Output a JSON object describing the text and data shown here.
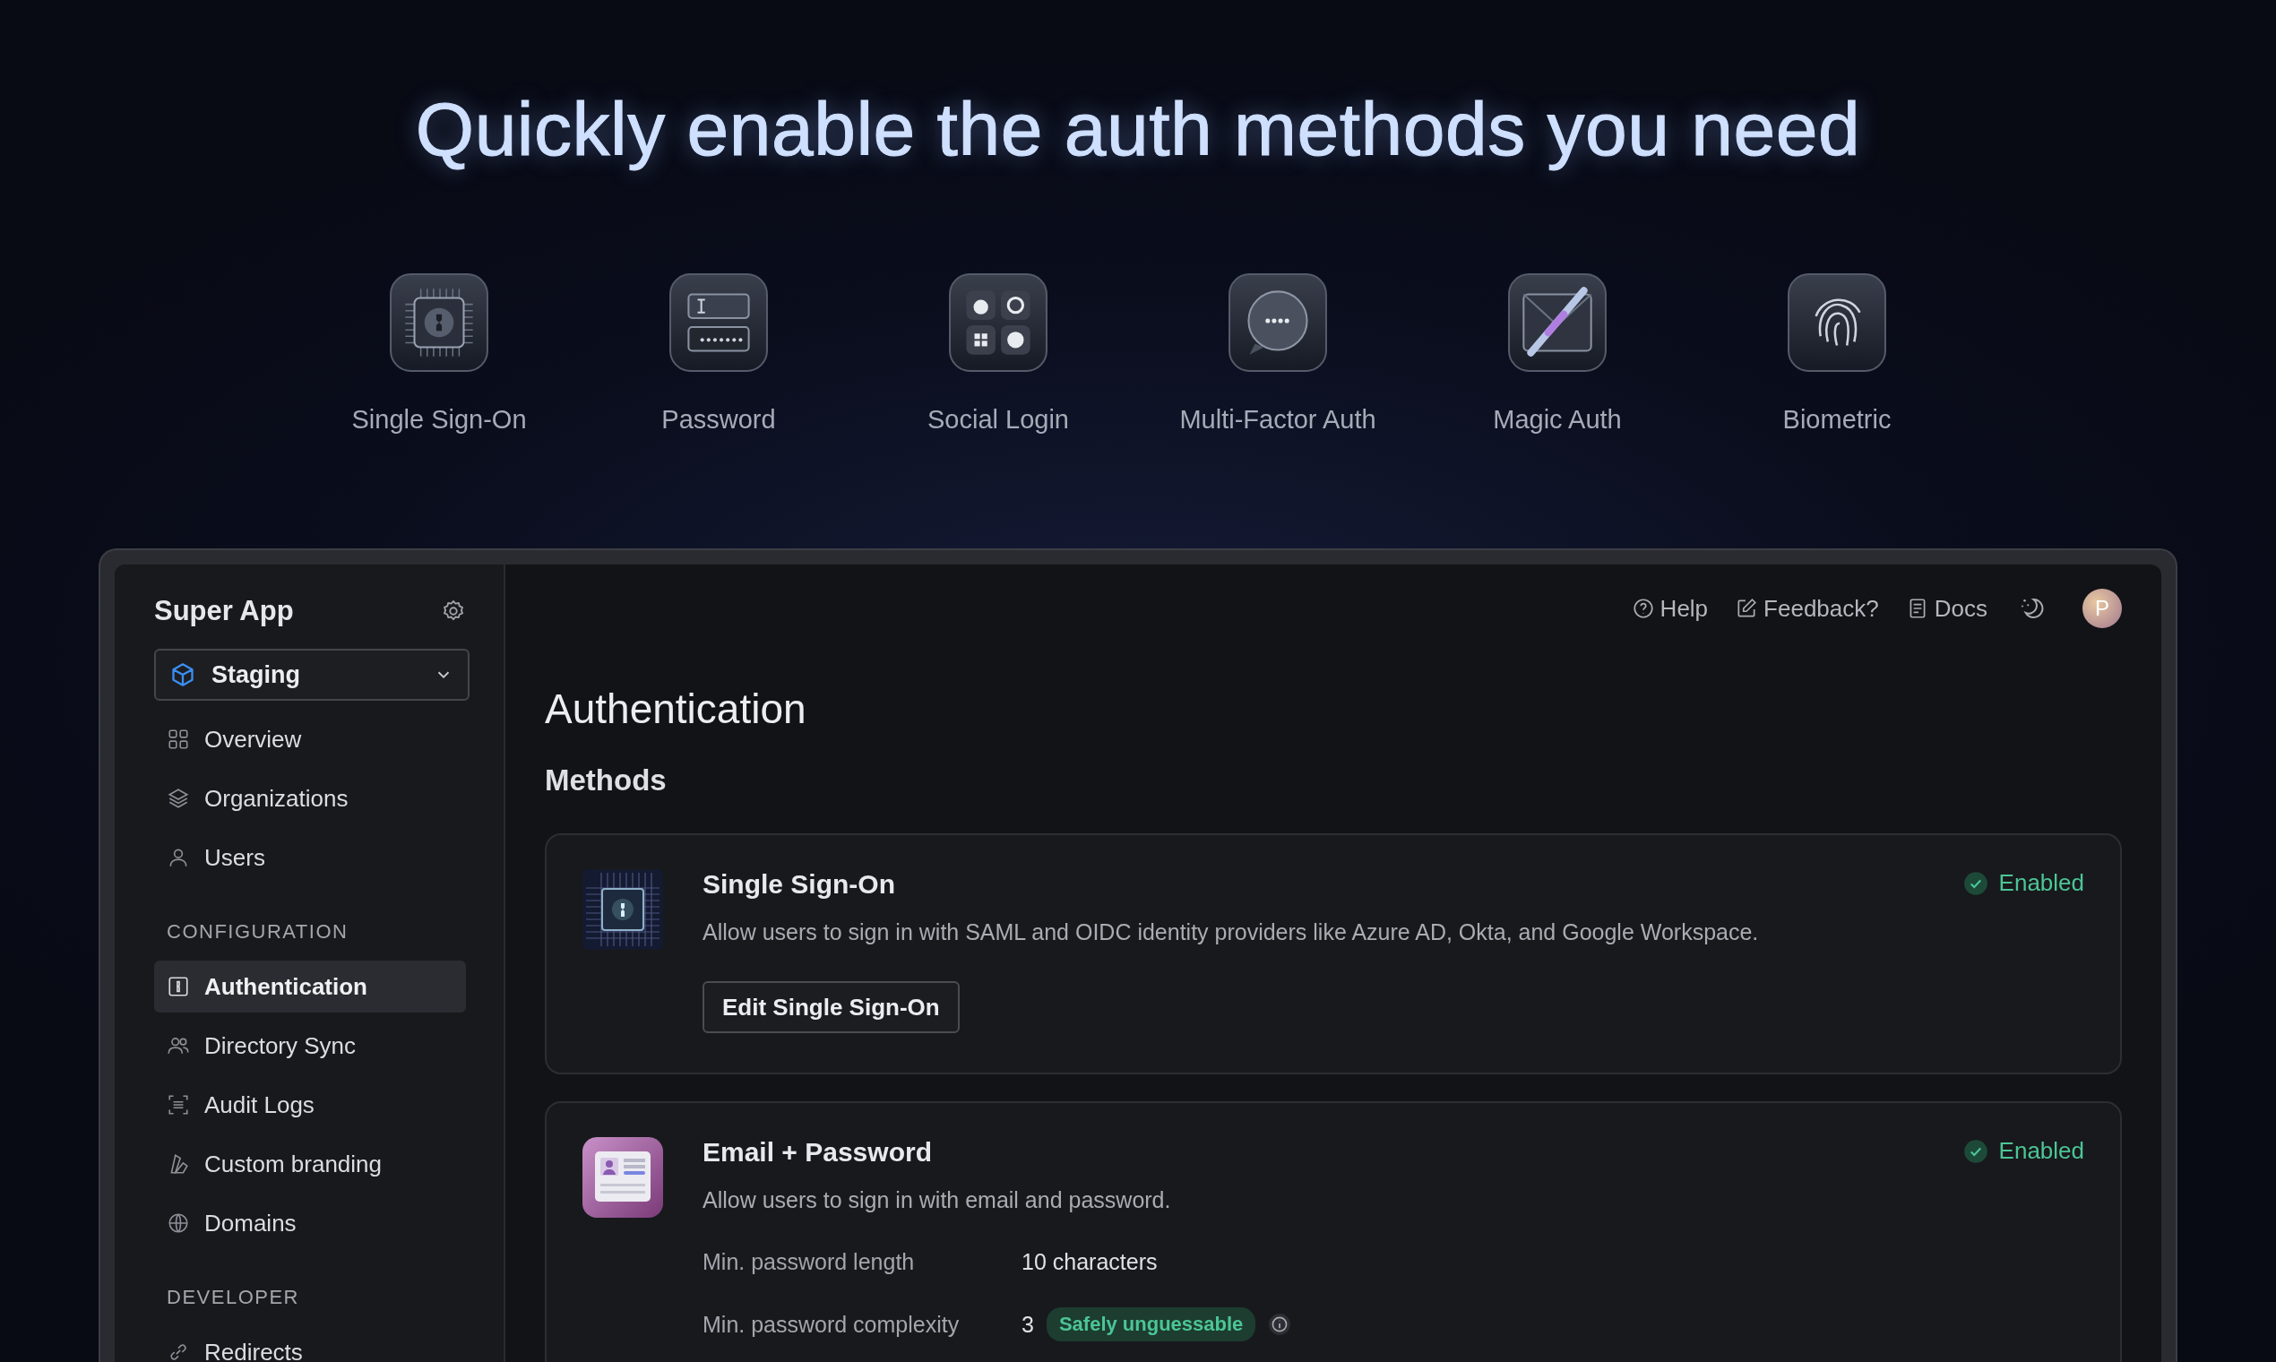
{
  "headline": "Quickly enable the auth methods you need",
  "showcase": [
    {
      "label": "Single Sign-On",
      "kind": "sso"
    },
    {
      "label": "Password",
      "kind": "password"
    },
    {
      "label": "Social Login",
      "kind": "social"
    },
    {
      "label": "Multi-Factor Auth",
      "kind": "mfa"
    },
    {
      "label": "Magic Auth",
      "kind": "magic"
    },
    {
      "label": "Biometric",
      "kind": "biometric"
    }
  ],
  "sidebar": {
    "app_name": "Super App",
    "environment": "Staging",
    "sections": [
      {
        "items": [
          {
            "label": "Overview",
            "kind": "grid",
            "selected": false
          },
          {
            "label": "Organizations",
            "kind": "layers",
            "selected": false
          },
          {
            "label": "Users",
            "kind": "user",
            "selected": false
          }
        ]
      },
      {
        "heading": "CONFIGURATION",
        "items": [
          {
            "label": "Authentication",
            "kind": "auth",
            "selected": true
          },
          {
            "label": "Directory Sync",
            "kind": "users",
            "selected": false
          },
          {
            "label": "Audit Logs",
            "kind": "logs",
            "selected": false
          },
          {
            "label": "Custom branding",
            "kind": "brand",
            "selected": false
          },
          {
            "label": "Domains",
            "kind": "globe",
            "selected": false
          }
        ]
      },
      {
        "heading": "DEVELOPER",
        "items": [
          {
            "label": "Redirects",
            "kind": "link",
            "selected": false
          }
        ]
      }
    ]
  },
  "topbar": {
    "links": [
      {
        "label": "Help",
        "kind": "help"
      },
      {
        "label": "Feedback?",
        "kind": "feedback"
      },
      {
        "label": "Docs",
        "kind": "docs"
      }
    ],
    "avatar": "P"
  },
  "page_title": "Authentication",
  "section_title": "Methods",
  "methods": [
    {
      "kind": "sso",
      "title": "Single Sign-On",
      "description": "Allow users to sign in with SAML and OIDC identity providers like Azure AD, Okta, and Google Workspace.",
      "status": "Enabled",
      "enabled": true,
      "button": "Edit Single Sign-On"
    },
    {
      "kind": "password",
      "title": "Email + Password",
      "description": "Allow users to sign in with email and password.",
      "status": "Enabled",
      "enabled": true,
      "settings": [
        {
          "label": "Min. password length",
          "value": "10 characters"
        },
        {
          "label": "Min. password complexity",
          "value": "3",
          "badge": "Safely unguessable",
          "info": true
        }
      ]
    }
  ]
}
